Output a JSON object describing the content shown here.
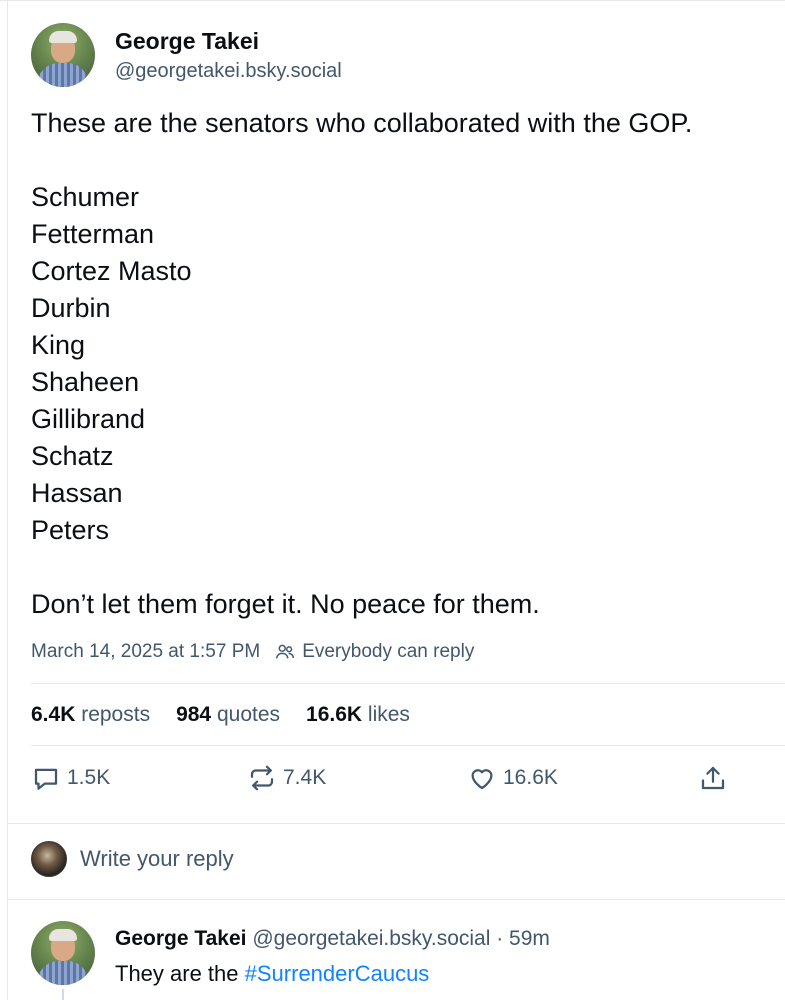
{
  "post": {
    "author_name": "George Takei",
    "author_handle": "@georgetakei.bsky.social",
    "text_intro": "These are the senators who collaborated with the GOP.",
    "senators": [
      "Schumer",
      "Fetterman",
      "Cortez Masto",
      "Durbin",
      "King",
      "Shaheen",
      "Gillibrand",
      "Schatz",
      "Hassan",
      "Peters"
    ],
    "text_outro": "Don’t let them forget it. No peace for them.",
    "timestamp": "March 14, 2025 at 1:57 PM",
    "reply_setting": "Everybody can reply",
    "reply_setting_icon": "people-icon"
  },
  "stats": {
    "reposts_count": "6.4K",
    "reposts_label": "reposts",
    "quotes_count": "984",
    "quotes_label": "quotes",
    "likes_count": "16.6K",
    "likes_label": "likes"
  },
  "actions": {
    "reply_count": "1.5K",
    "reply_icon": "speech-bubble-icon",
    "repost_count": "7.4K",
    "repost_icon": "repost-arrows-icon",
    "like_count": "16.6K",
    "like_icon": "heart-icon",
    "share_icon": "share-icon"
  },
  "composer": {
    "placeholder": "Write your reply"
  },
  "reply": {
    "author_name": "George Takei",
    "author_handle": "@georgetakei.bsky.social",
    "age": "· 59m",
    "text_prefix": "They are the ",
    "hashtag": "#SurrenderCaucus"
  },
  "colors": {
    "text_primary": "#0b0f14",
    "text_secondary": "#42576c",
    "link": "#1083fe",
    "divider": "#e4e7eb"
  }
}
